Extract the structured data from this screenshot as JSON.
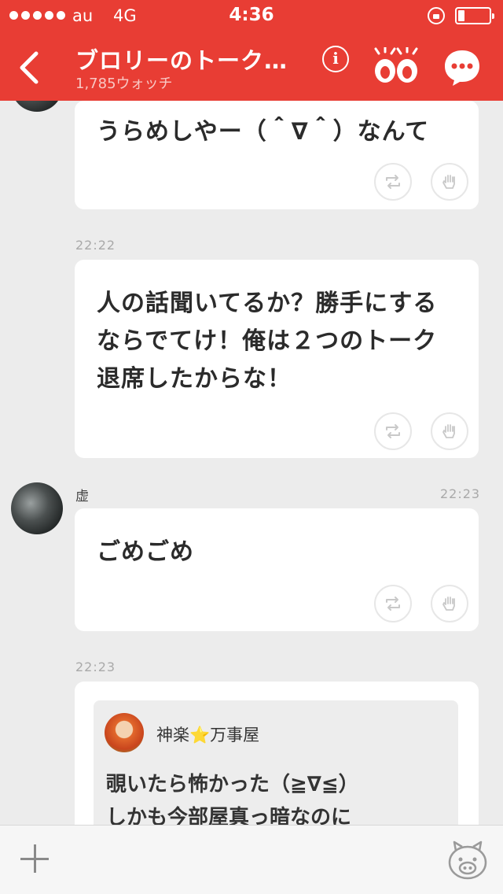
{
  "status": {
    "carrier": "au",
    "network": "4G",
    "time": "4:36"
  },
  "header": {
    "title": "ブロリーのトーク…",
    "subtitle": "1,785ウォッチ",
    "info_glyph": "i",
    "accent_color": "#e83d34"
  },
  "messages": [
    {
      "text": "うらめしやー（＾∇＾）なんて"
    },
    {
      "timestamp": "22:22",
      "text": "人の話聞いてるか？勝手にするならでてけ！俺は２つのトーク退席したからな！"
    },
    {
      "sender": "虚",
      "timestamp": "22:23",
      "text": "ごめごめ"
    },
    {
      "timestamp": "22:23",
      "quote": {
        "name_a": "神楽",
        "star": "⭐",
        "name_b": "万事屋",
        "line1": "覗いたら怖かった（≧∇≦）",
        "line2": "しかも今部屋真っ暗なのに"
      }
    }
  ],
  "icons": {
    "back": "chevron-left-icon",
    "info": "info-icon",
    "watch": "eyes-icon",
    "chat": "chat-bubble-icon",
    "repost": "repost-icon",
    "like": "hand-icon",
    "add": "plus-icon",
    "stamp": "pig-stamp-icon"
  }
}
